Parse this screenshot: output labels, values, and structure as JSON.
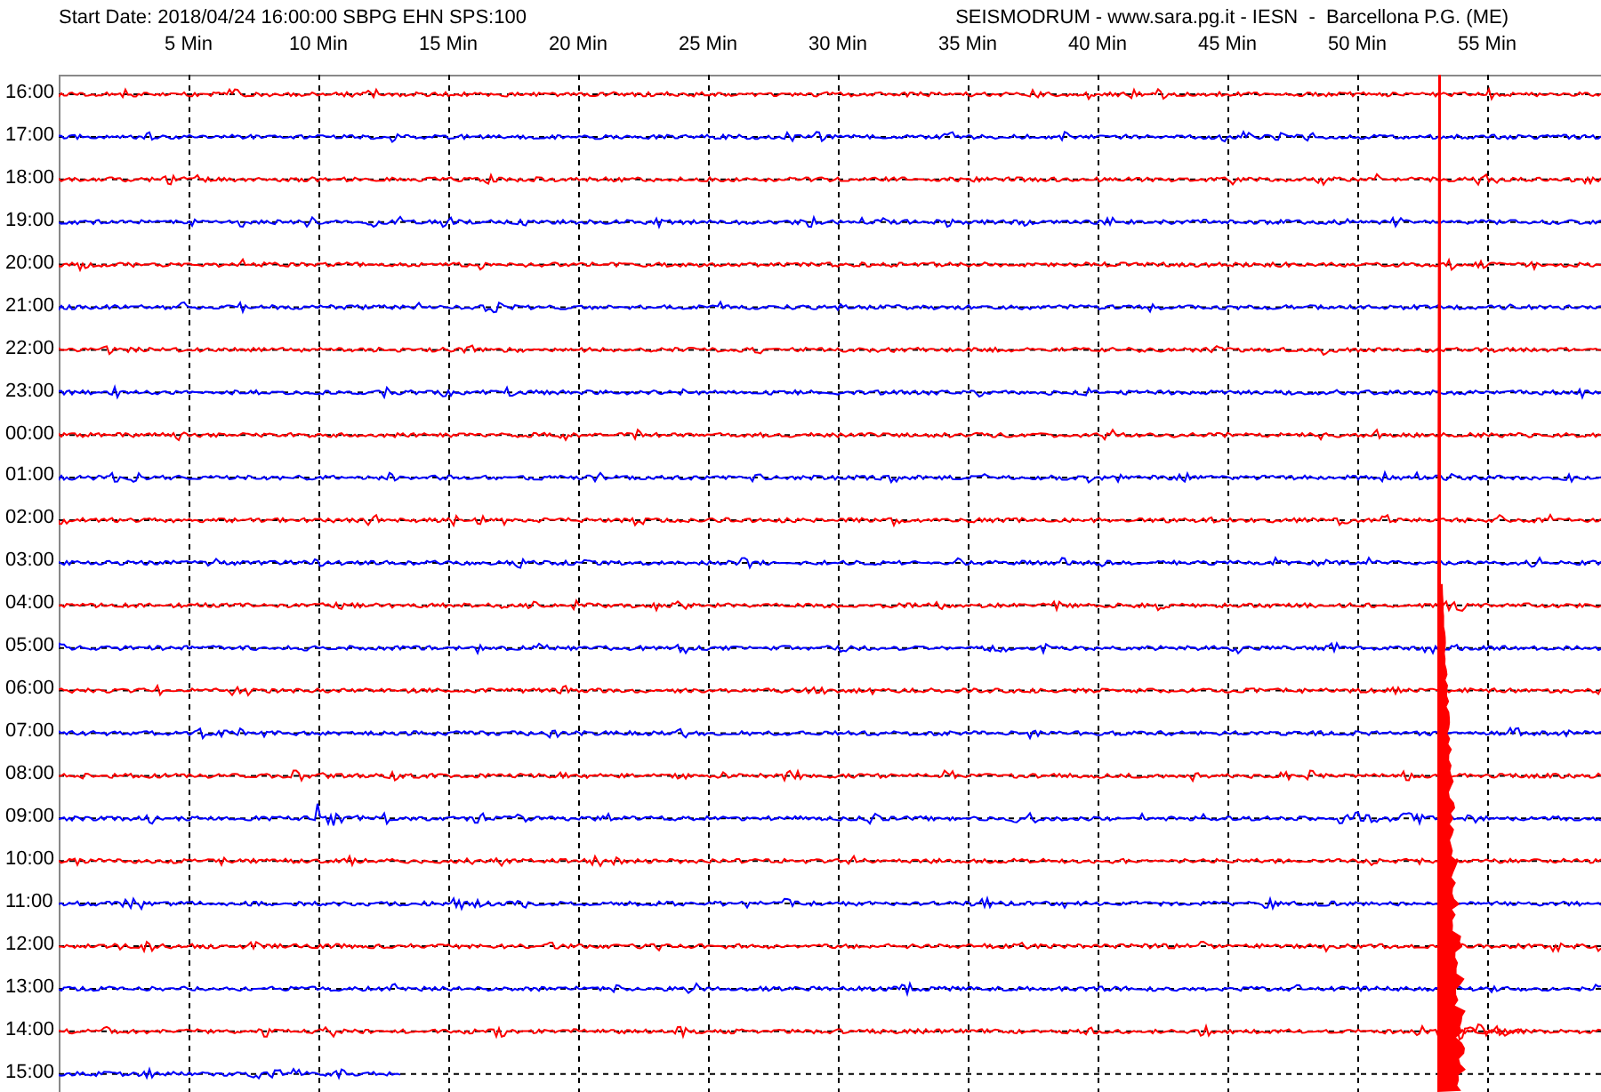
{
  "header": {
    "start_info": "Start Date: 2018/04/24 16:00:00 SBPG EHN SPS:100",
    "station_info": "SEISMODRUM - www.sara.pg.it - IESN  -  Barcellona P.G. (ME)"
  },
  "minute_ticks": [
    "5 Min",
    "10 Min",
    "15 Min",
    "20 Min",
    "25 Min",
    "30 Min",
    "35 Min",
    "40 Min",
    "45 Min",
    "50 Min",
    "55 Min"
  ],
  "rows": [
    {
      "time": "16:00",
      "color": "#ff0000",
      "level": 1
    },
    {
      "time": "17:00",
      "color": "#0000ff",
      "level": 1
    },
    {
      "time": "18:00",
      "color": "#ff0000",
      "level": 1
    },
    {
      "time": "19:00",
      "color": "#0000ff",
      "level": 1
    },
    {
      "time": "20:00",
      "color": "#ff0000",
      "level": 1
    },
    {
      "time": "21:00",
      "color": "#0000ff",
      "level": 1
    },
    {
      "time": "22:00",
      "color": "#ff0000",
      "level": 1
    },
    {
      "time": "23:00",
      "color": "#0000ff",
      "level": 1
    },
    {
      "time": "00:00",
      "color": "#ff0000",
      "level": 1
    },
    {
      "time": "01:00",
      "color": "#0000ff",
      "level": 1
    },
    {
      "time": "02:00",
      "color": "#ff0000",
      "level": 1
    },
    {
      "time": "03:00",
      "color": "#0000ff",
      "level": 1
    },
    {
      "time": "04:00",
      "color": "#ff0000",
      "level": 1
    },
    {
      "time": "05:00",
      "color": "#0000ff",
      "level": 1
    },
    {
      "time": "06:00",
      "color": "#ff0000",
      "level": 1
    },
    {
      "time": "07:00",
      "color": "#0000ff",
      "level": 1
    },
    {
      "time": "08:00",
      "color": "#ff0000",
      "level": 1
    },
    {
      "time": "09:00",
      "color": "#0000ff",
      "level": 1
    },
    {
      "time": "10:00",
      "color": "#ff0000",
      "level": 1
    },
    {
      "time": "11:00",
      "color": "#0000ff",
      "level": 1
    },
    {
      "time": "12:00",
      "color": "#ff0000",
      "level": 1
    },
    {
      "time": "13:00",
      "color": "#0000ff",
      "level": 1
    },
    {
      "time": "14:00",
      "color": "#ff0000",
      "level": 1
    },
    {
      "time": "15:00",
      "color": "#0000ff",
      "level": 0.22
    }
  ]
}
